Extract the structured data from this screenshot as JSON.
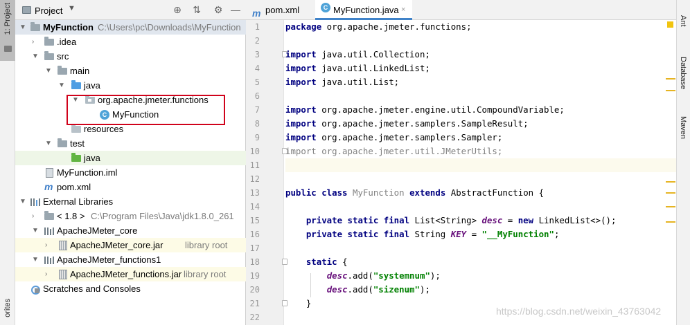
{
  "left_strip": {
    "project_tab": "1: Project",
    "favorites_tab": "orites"
  },
  "project_panel": {
    "title": "Project",
    "caret": "▼",
    "tools": [
      "⊕",
      "⇅",
      "⚙",
      "—"
    ],
    "tree": [
      {
        "label": "MyFunction",
        "path": "C:\\Users\\pc\\Downloads\\MyFunction",
        "bold": true,
        "arrow": "▼",
        "icon": "folder",
        "selected": true
      },
      {
        "label": ".idea",
        "arrow": "›",
        "icon": "folder"
      },
      {
        "label": "src",
        "arrow": "▼",
        "icon": "folder"
      },
      {
        "label": "main",
        "arrow": "▼",
        "icon": "folder"
      },
      {
        "label": "java",
        "arrow": "▼",
        "icon": "folder-blue"
      },
      {
        "label": "org.apache.jmeter.functions",
        "arrow": "▼",
        "icon": "package"
      },
      {
        "label": "MyFunction",
        "icon": "class",
        "class_letter": "C"
      },
      {
        "label": "resources",
        "icon": "folder-resources"
      },
      {
        "label": "test",
        "arrow": "▼",
        "icon": "folder"
      },
      {
        "label": "java",
        "icon": "folder-green",
        "highlight": "green"
      },
      {
        "label": "MyFunction.iml",
        "icon": "iml"
      },
      {
        "label": "pom.xml",
        "icon": "maven",
        "icon_glyph": "m"
      },
      {
        "label": "External Libraries",
        "arrow": "▼",
        "icon": "library"
      },
      {
        "label": "< 1.8 >",
        "path": "C:\\Program Files\\Java\\jdk1.8.0_261",
        "arrow": "›",
        "icon": "jdk-folder"
      },
      {
        "label": "ApacheJMeter_core",
        "arrow": "▼",
        "icon": "library"
      },
      {
        "label": "ApacheJMeter_core.jar",
        "path": "library root",
        "arrow": "›",
        "icon": "jar",
        "highlight": "yellow"
      },
      {
        "label": "ApacheJMeter_functions1",
        "arrow": "▼",
        "icon": "library"
      },
      {
        "label": "ApacheJMeter_functions.jar",
        "path": "library root",
        "arrow": "›",
        "icon": "jar",
        "highlight": "yellow"
      },
      {
        "label": "Scratches and Consoles",
        "icon": "scratches"
      }
    ]
  },
  "editor": {
    "tabs": [
      {
        "label": "pom.xml",
        "icon": "m",
        "active": false
      },
      {
        "label": "MyFunction.java",
        "icon": "C",
        "active": true,
        "close": "×"
      }
    ],
    "line_numbers": [
      "1",
      "2",
      "3",
      "4",
      "5",
      "6",
      "7",
      "8",
      "9",
      "10",
      "11",
      "12",
      "13",
      "14",
      "15",
      "16",
      "17",
      "18",
      "19",
      "20",
      "21",
      "22"
    ],
    "code_lines": [
      [
        {
          "t": "package",
          "c": "kw"
        },
        {
          "t": " org.apache.jmeter.functions;"
        }
      ],
      [],
      [
        {
          "t": "import",
          "c": "kw"
        },
        {
          "t": " java.util.Collection;"
        }
      ],
      [
        {
          "t": "import",
          "c": "kw"
        },
        {
          "t": " java.util.LinkedList;"
        }
      ],
      [
        {
          "t": "import",
          "c": "kw"
        },
        {
          "t": " java.util.List;"
        }
      ],
      [],
      [
        {
          "t": "import",
          "c": "kw"
        },
        {
          "t": " org.apache.jmeter.engine.util.CompoundVariable;"
        }
      ],
      [
        {
          "t": "import",
          "c": "kw"
        },
        {
          "t": " org.apache.jmeter.samplers.SampleResult;"
        }
      ],
      [
        {
          "t": "import",
          "c": "kw"
        },
        {
          "t": " org.apache.jmeter.samplers.Sampler;"
        }
      ],
      [
        {
          "t": "import org.apache.jmeter.util.JMeterUtils;",
          "c": "unused"
        }
      ],
      [],
      [],
      [
        {
          "t": "public class",
          "c": "kw"
        },
        {
          "t": " "
        },
        {
          "t": "MyFunction",
          "c": "cls-decl"
        },
        {
          "t": " "
        },
        {
          "t": "extends",
          "c": "kw"
        },
        {
          "t": " AbstractFunction {"
        }
      ],
      [],
      [
        {
          "t": "    "
        },
        {
          "t": "private static final",
          "c": "kw"
        },
        {
          "t": " List<String> "
        },
        {
          "t": "desc",
          "c": "fld"
        },
        {
          "t": " = "
        },
        {
          "t": "new",
          "c": "kw"
        },
        {
          "t": " LinkedList<>();"
        }
      ],
      [
        {
          "t": "    "
        },
        {
          "t": "private static final",
          "c": "kw"
        },
        {
          "t": " String "
        },
        {
          "t": "KEY",
          "c": "fld"
        },
        {
          "t": " = "
        },
        {
          "t": "\"__MyFunction\"",
          "c": "str"
        },
        {
          "t": ";"
        }
      ],
      [],
      [
        {
          "t": "    "
        },
        {
          "t": "static",
          "c": "kw"
        },
        {
          "t": " {"
        }
      ],
      [
        {
          "t": "        "
        },
        {
          "t": "desc",
          "c": "fld"
        },
        {
          "t": ".add("
        },
        {
          "t": "\"systemnum\"",
          "c": "str"
        },
        {
          "t": ");"
        }
      ],
      [
        {
          "t": "        "
        },
        {
          "t": "desc",
          "c": "fld"
        },
        {
          "t": ".add("
        },
        {
          "t": "\"sizenum\"",
          "c": "str"
        },
        {
          "t": ");"
        }
      ],
      [
        {
          "t": "    }"
        }
      ],
      []
    ]
  },
  "right_strip": {
    "ant": "Ant",
    "database": "Database",
    "maven": "Maven"
  },
  "watermark": "https://blog.csdn.net/weixin_43763042",
  "colors": {
    "selection": "#e0e6ee",
    "red_box": "#d0021b",
    "keyword": "#000080",
    "string": "#008000",
    "field": "#660e7a"
  }
}
